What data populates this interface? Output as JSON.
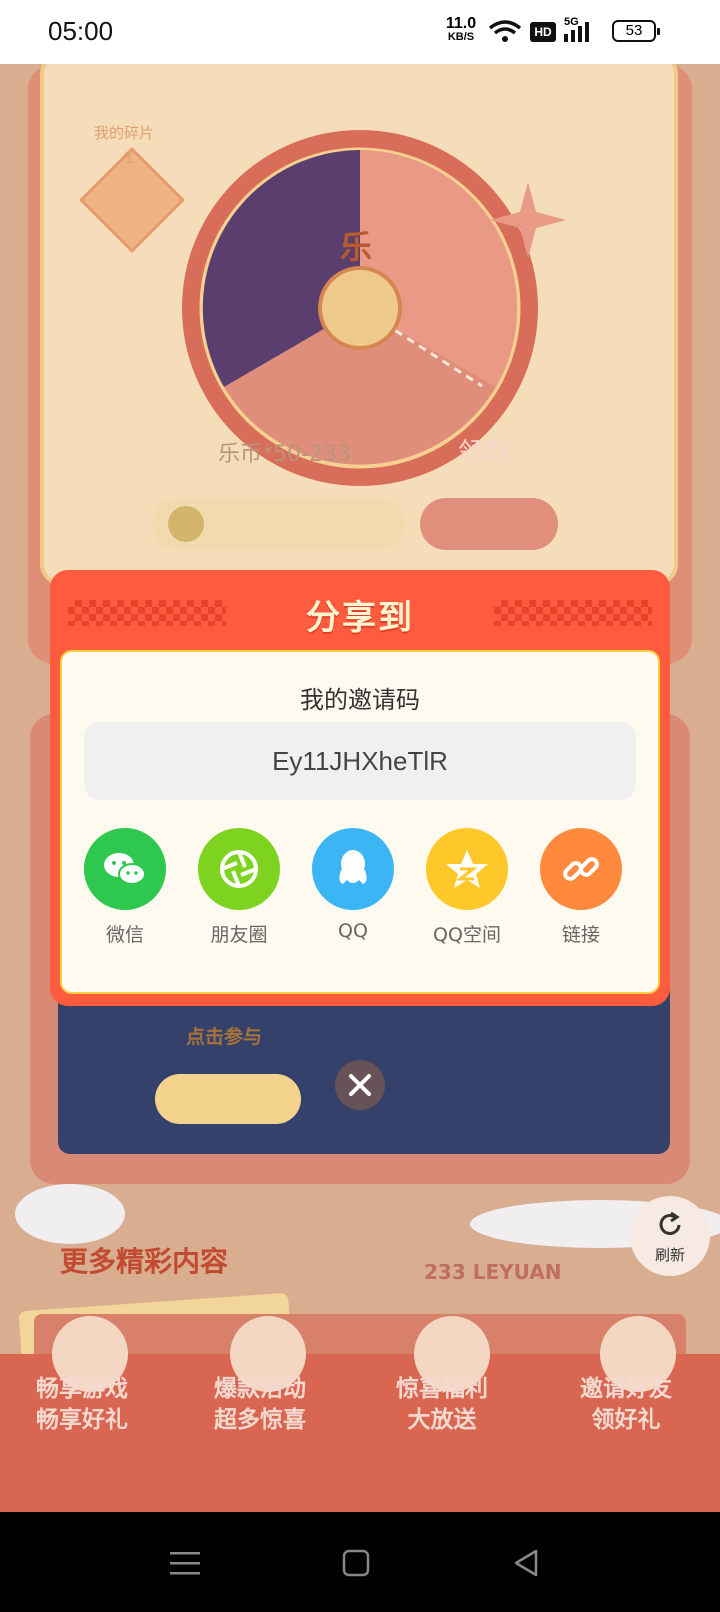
{
  "status_bar": {
    "time": "05:00",
    "net_speed_value": "11.0",
    "net_speed_unit": "KB/S",
    "hd": "HD",
    "signal": "5G",
    "battery": "53"
  },
  "background": {
    "fragments_label": "我的碎片",
    "fragments_count": "1",
    "wheel_center": "乐",
    "reward_text": "乐币*50-233",
    "claim_button": "领取",
    "participate_button": "点击参与",
    "more_content_title": "更多精彩内容",
    "brand_text": "233 LEYUAN",
    "banner_items": [
      {
        "line1": "畅享游戏",
        "line2": "畅享好礼"
      },
      {
        "line1": "爆款活动",
        "line2": "超多惊喜"
      },
      {
        "line1": "惊喜福利",
        "line2": "大放送"
      },
      {
        "line1": "邀请好友",
        "line2": "领好礼"
      }
    ]
  },
  "refresh_label": "刷新",
  "modal": {
    "title": "分享到",
    "invite_label": "我的邀请码",
    "invite_code": "Ey11JHXheTlR",
    "options": [
      {
        "label": "微信",
        "color": "#2dc84d",
        "icon": "wechat-icon"
      },
      {
        "label": "朋友圈",
        "color": "#7ed321",
        "icon": "moments-icon"
      },
      {
        "label": "QQ",
        "color": "#3cb5f5",
        "icon": "qq-icon"
      },
      {
        "label": "QQ空间",
        "color": "#ffc82a",
        "icon": "qzone-icon"
      },
      {
        "label": "链接",
        "color": "#ff8a3d",
        "icon": "link-icon"
      }
    ]
  }
}
